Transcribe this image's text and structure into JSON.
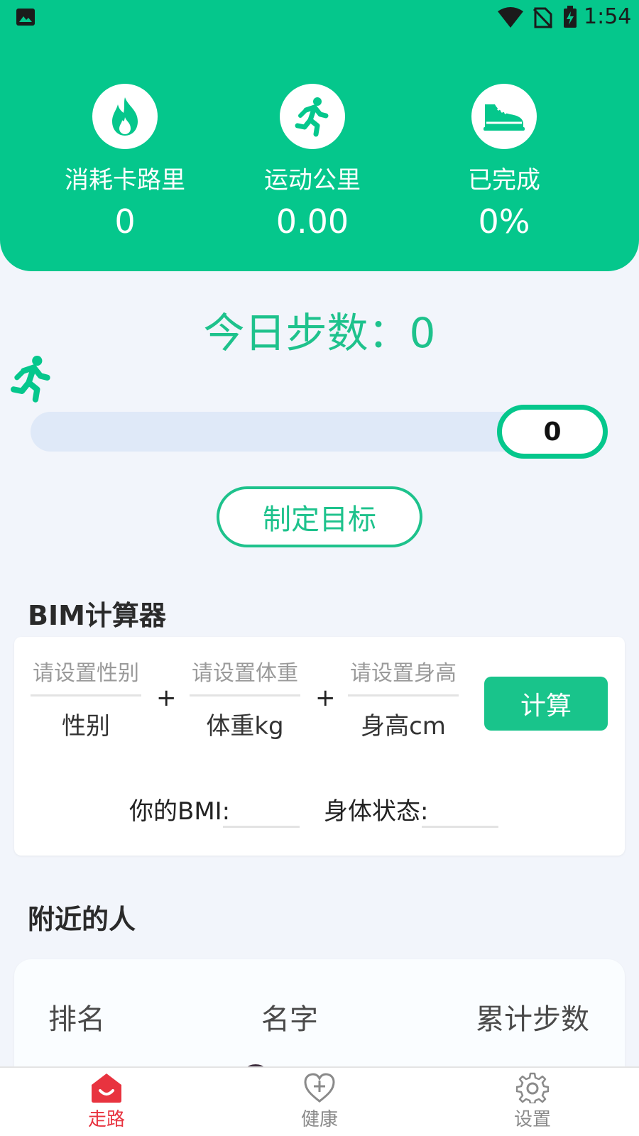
{
  "status_bar": {
    "time": "1:54"
  },
  "stats": [
    {
      "icon": "flame-icon",
      "label": "消耗卡路里",
      "value": "0"
    },
    {
      "icon": "runner-icon",
      "label": "运动公里",
      "value": "0.00"
    },
    {
      "icon": "sneaker-icon",
      "label": "已完成",
      "value": "0%"
    }
  ],
  "steps": {
    "title": "今日步数：0",
    "progress_value": "0",
    "progress_fraction": 0
  },
  "goal_button": "制定目标",
  "bmi": {
    "section_title": "BIM计算器",
    "fields": [
      {
        "placeholder": "请设置性别",
        "caption": "性别"
      },
      {
        "placeholder": "请设置体重",
        "caption": "体重kg"
      },
      {
        "placeholder": "请设置身高",
        "caption": "身高cm"
      }
    ],
    "plus": "+",
    "calc_button": "计算",
    "result_label": "你的BMI:",
    "status_label": "身体状态:"
  },
  "nearby": {
    "section_title": "附近的人",
    "headers": [
      "排名",
      "名字",
      "累计步数"
    ]
  },
  "bottom_nav": [
    {
      "icon": "home-icon",
      "label": "走路",
      "active": true
    },
    {
      "icon": "heart-plus-icon",
      "label": "健康",
      "active": false
    },
    {
      "icon": "gear-icon",
      "label": "设置",
      "active": false
    }
  ],
  "colors": {
    "primary": "#05c78c",
    "active_nav": "#e8333f",
    "inactive_nav": "#8a8a8a"
  }
}
